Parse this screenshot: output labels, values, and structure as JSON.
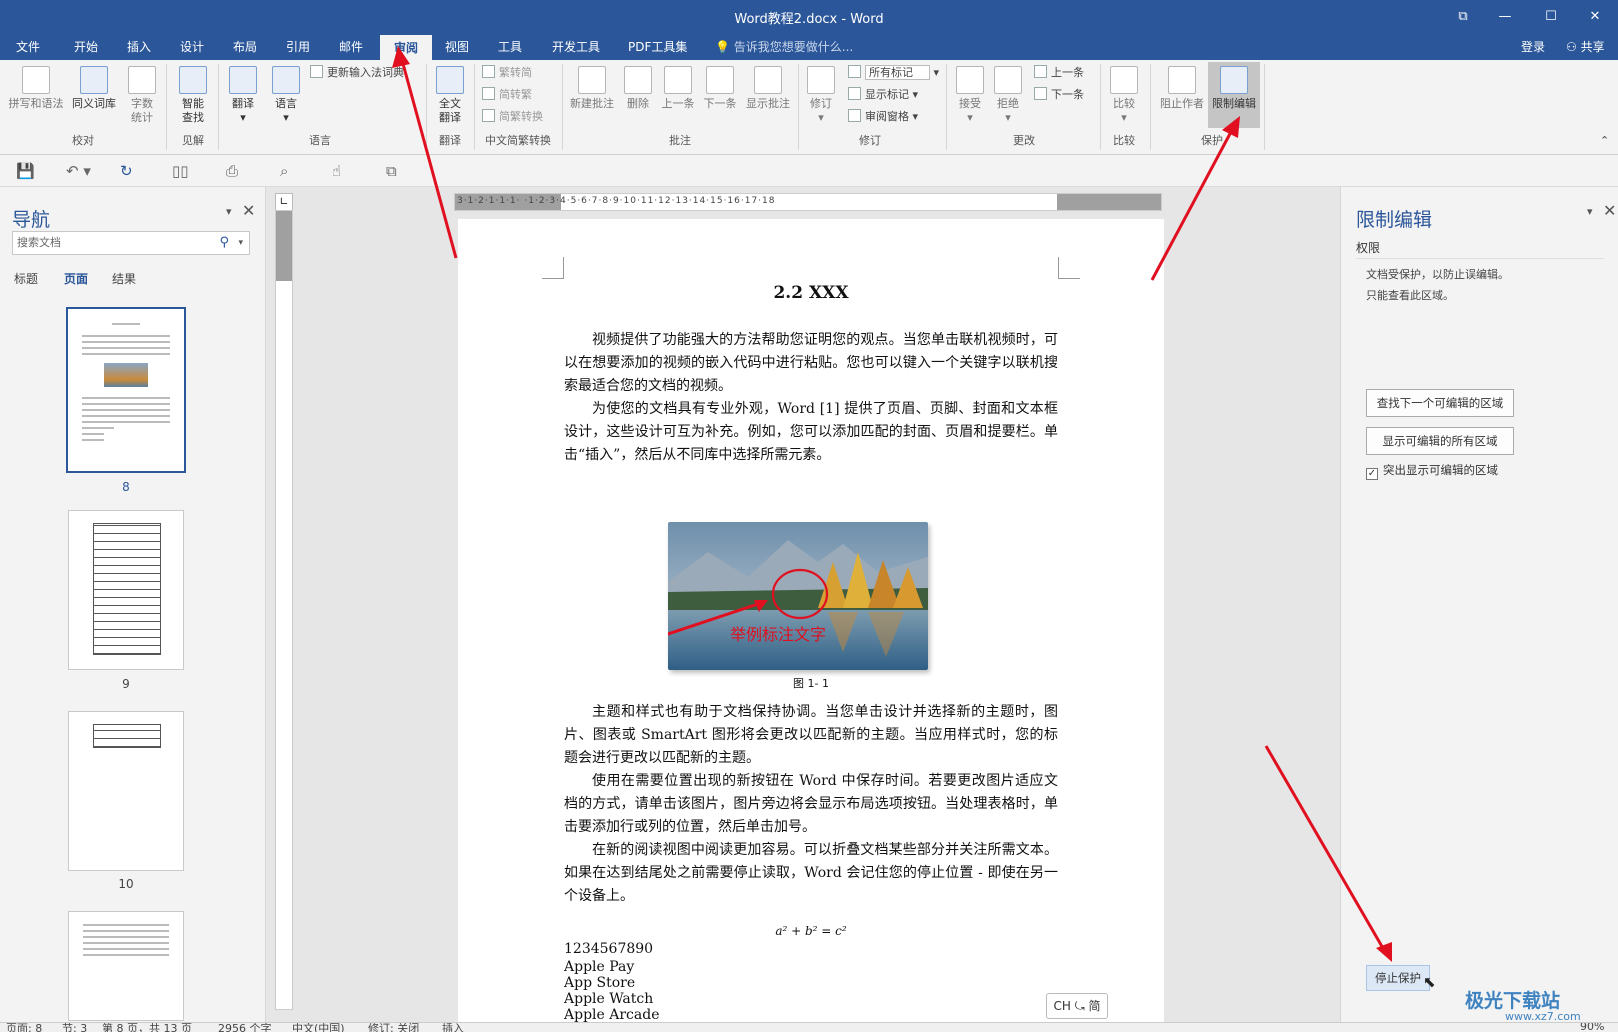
{
  "window": {
    "title": "Word教程2.docx - Word",
    "controls": [
      "⧉",
      "—",
      "☐",
      "✕"
    ]
  },
  "menu": {
    "tabs": [
      "文件",
      "开始",
      "插入",
      "设计",
      "布局",
      "引用",
      "邮件",
      "审阅",
      "视图",
      "工具",
      "开发工具",
      "PDF工具集"
    ],
    "active": "审阅",
    "tell_me": "告诉我您想要做什么...",
    "login": "登录",
    "share": "共享"
  },
  "ribbon": {
    "spelling": "拼写和语法",
    "thesaurus": "同义词库",
    "word_count_1": "字数",
    "word_count_2": "统计",
    "smart_1": "智能",
    "smart_2": "查找",
    "translate": "翻译",
    "language": "语言",
    "update_ime": "更新输入法词典",
    "full_1": "全文",
    "full_2": "翻译",
    "to_simp": "繁转简",
    "to_trad": "简转繁",
    "convert": "简繁转换",
    "new_comment": "新建批注",
    "delete": "删除",
    "prev": "上一条",
    "next": "下一条",
    "show_comments": "显示批注",
    "track": "修订",
    "all_markup": "所有标记",
    "show_markup": "显示标记",
    "review_pane": "审阅窗格",
    "accept": "接受",
    "reject": "拒绝",
    "prev_change": "上一条",
    "next_change": "下一条",
    "compare": "比较",
    "block_authors": "阻止作者",
    "restrict_editing": "限制编辑",
    "groups": {
      "proofing": "校对",
      "insights": "见解",
      "language": "语言",
      "translate": "翻译",
      "conversion": "中文简繁转换",
      "comments": "批注",
      "tracking": "修订",
      "changes": "更改",
      "compare": "比较",
      "protect": "保护"
    }
  },
  "nav": {
    "title": "导航",
    "search_placeholder": "搜索文档",
    "tabs": [
      "标题",
      "页面",
      "结果"
    ],
    "active_tab": "页面",
    "pages": [
      "8",
      "9",
      "10"
    ]
  },
  "ruler": {
    "ticks": "3·1·2·1·1·1·  ·1·2·3·4·5·6·7·8·9·10·11·12·13·14·15·16·17·18"
  },
  "document": {
    "heading": "2.2 XXX",
    "p1": "视频提供了功能强大的方法帮助您证明您的观点。当您单击联机视频时，可以在想要添加的视频的嵌入代码中进行粘贴。您也可以键入一个关键字以联机搜索最适合您的文档的视频。",
    "p2": "为使您的文档具有专业外观，Word [1] 提供了页眉、页脚、封面和文本框设计，这些设计可互为补充。例如，您可以添加匹配的封面、页眉和提要栏。单击“插入”，然后从不同库中选择所需元素。",
    "image_annotation": "举例标注文字",
    "caption": "图 1- 1",
    "p3": "主题和样式也有助于文档保持协调。当您单击设计并选择新的主题时，图片、图表或 SmartArt 图形将会更改以匹配新的主题。当应用样式时，您的标题会进行更改以匹配新的主题。",
    "p4": "使用在需要位置出现的新按钮在 Word 中保存时间。若要更改图片适应文档的方式，请单击该图片，图片旁边将会显示布局选项按钮。当处理表格时，单击要添加行或列的位置，然后单击加号。",
    "p5": "在新的阅读视图中阅读更加容易。可以折叠文档某些部分并关注所需文本。如果在达到结尾处之前需要停止读取，Word 会记住您的停止位置 - 即使在另一个设备上。",
    "formula": "a² + b² = c²",
    "lines": [
      "1234567890",
      "Apple Pay",
      "App Store",
      "Apple Watch",
      "Apple Arcade"
    ]
  },
  "ime": "CH ⤿ 简",
  "restrict_pane": {
    "title": "限制编辑",
    "section": "权限",
    "msg1": "文档受保护，以防止误编辑。",
    "msg2": "只能查看此区域。",
    "find_next": "查找下一个可编辑的区域",
    "show_all": "显示可编辑的所有区域",
    "highlight": "突出显示可编辑的区域",
    "stop": "停止保护"
  },
  "status": {
    "page": "页面: 8",
    "section": "节: 3",
    "pages": "第 8 页，共 13 页",
    "words": "2956 个字",
    "lang": "中文(中国)",
    "track": "修订: 关闭",
    "insert": "插入",
    "zoom": "90%"
  },
  "watermark": {
    "brand": "极光下载站",
    "url": "www.xz7.com"
  }
}
